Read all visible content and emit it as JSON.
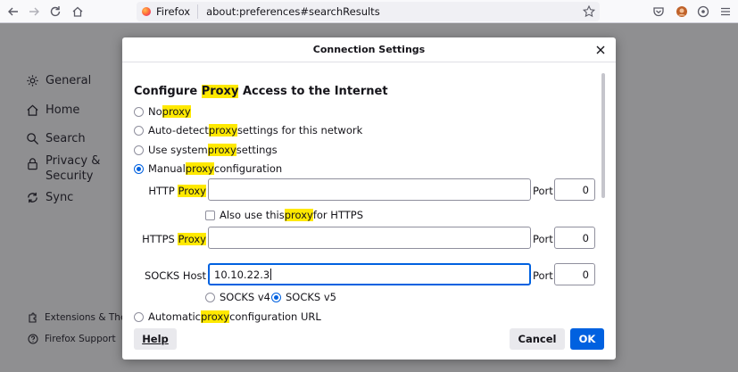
{
  "toolbar": {
    "back_icon": "back-arrow-icon",
    "forward_icon": "forward-arrow-icon",
    "reload_icon": "reload-icon",
    "home_icon": "home-icon",
    "identity_label": "Firefox",
    "url": "about:preferences#searchResults",
    "right_icons": [
      "pocket-icon",
      "account-icon",
      "extensions-icon",
      "menu-icon"
    ]
  },
  "sidebar": {
    "items": [
      {
        "label": "General",
        "icon": "gear-icon"
      },
      {
        "label": "Home",
        "icon": "home-icon"
      },
      {
        "label": "Search",
        "icon": "search-icon"
      },
      {
        "label": "Privacy &",
        "label2": "Security",
        "icon": "lock-icon"
      },
      {
        "label": "Sync",
        "icon": "sync-icon"
      }
    ],
    "footer": [
      {
        "label": "Extensions & The",
        "icon": "puzzle-icon"
      },
      {
        "label": "Firefox Support",
        "icon": "help-icon"
      }
    ]
  },
  "dialog": {
    "title": "Connection Settings",
    "section_title_pre": "Configure ",
    "section_title_hl": "Proxy",
    "section_title_post": " Access to the Internet",
    "options": [
      {
        "pre": "No ",
        "hl": "proxy",
        "post": "",
        "checked": false
      },
      {
        "pre": "Auto-detect ",
        "hl": "proxy",
        "post": " settings for this network",
        "checked": false
      },
      {
        "pre": "Use system ",
        "hl": "proxy",
        "post": " settings",
        "checked": false
      },
      {
        "pre": "Manual ",
        "hl": "proxy",
        "post": " configuration",
        "checked": true
      }
    ],
    "http_label_pre": "HTTP ",
    "http_label_hl": "Proxy",
    "http_value": "",
    "http_port": "0",
    "also_https_pre": "Also use this ",
    "also_https_hl": "proxy",
    "also_https_post": " for HTTPS",
    "https_label_pre": "HTTPS ",
    "https_label_hl": "Proxy",
    "https_value": "",
    "https_port": "0",
    "socks_label": "SOCKS Host",
    "socks_value": "10.10.22.3",
    "socks_port": "0",
    "port_label": "Port",
    "socks_v4": "SOCKS v4",
    "socks_v5": "SOCKS v5",
    "socks_v5_checked": true,
    "auto_url_pre": "Automatic ",
    "auto_url_hl": "proxy",
    "auto_url_post": " configuration URL",
    "help_label": "Help",
    "cancel_label": "Cancel",
    "ok_label": "OK"
  },
  "colors": {
    "accent": "#0061e0",
    "highlight": "#ffe900"
  }
}
